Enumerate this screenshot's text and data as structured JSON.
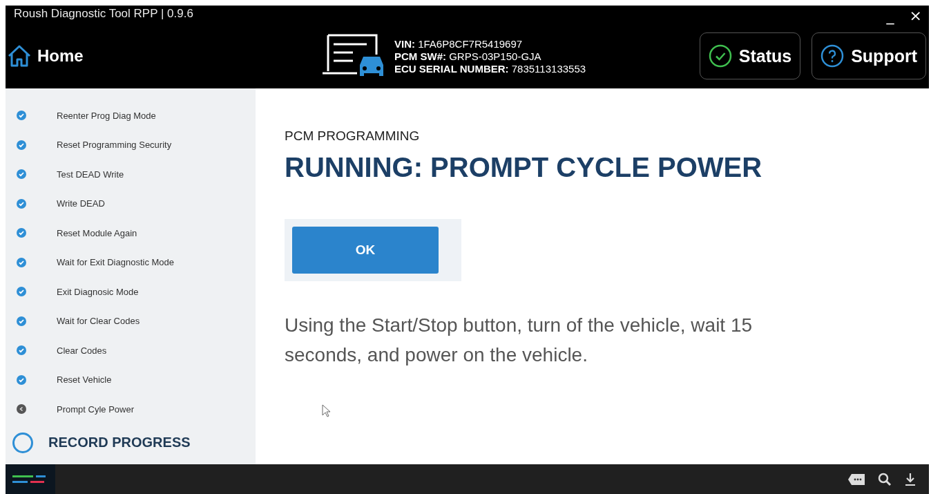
{
  "window": {
    "title": "Roush Diagnostic Tool RPP | 0.9.6",
    "controls": [
      "_",
      "×"
    ]
  },
  "header": {
    "home": "Home",
    "vehicle": [
      {
        "label": "VIN:",
        "value": "1FA6P8CF7R5419697"
      },
      {
        "label": "PCM SW#:",
        "value": "GRPS-03P150-GJA"
      },
      {
        "label": "ECU SERIAL NUMBER:",
        "value": "7835113133553"
      }
    ],
    "buttons": [
      {
        "kind": "status",
        "label": "Status"
      },
      {
        "kind": "support",
        "label": "Support"
      }
    ]
  },
  "sidebar": {
    "steps": [
      {
        "label": "Reenter Prog Diag Mode",
        "kind": "done"
      },
      {
        "label": "Reset Programming Security",
        "kind": "done"
      },
      {
        "label": "Test DEAD Write",
        "kind": "done"
      },
      {
        "label": "Write DEAD",
        "kind": "done"
      },
      {
        "label": "Reset Module Again",
        "kind": "done"
      },
      {
        "label": "Wait for Exit Diagnostic Mode",
        "kind": "done"
      },
      {
        "label": "Exit Diagnosic Mode",
        "kind": "done"
      },
      {
        "label": "Wait for Clear Codes",
        "kind": "done"
      },
      {
        "label": "Clear Codes",
        "kind": "done"
      },
      {
        "label": "Reset Vehicle",
        "kind": "done"
      },
      {
        "label": "Prompt Cyle Power",
        "kind": "current"
      }
    ],
    "record": {
      "label": "RECORD PROGRESS",
      "checked": false
    }
  },
  "main": {
    "section": "PCM PROGRAMMING",
    "heading": "RUNNING: PROMPT CYCLE POWER",
    "button": "OK",
    "message": "Using the Start/Stop button, turn of the vehicle, wait 15 seconds, and power on the vehicle."
  }
}
